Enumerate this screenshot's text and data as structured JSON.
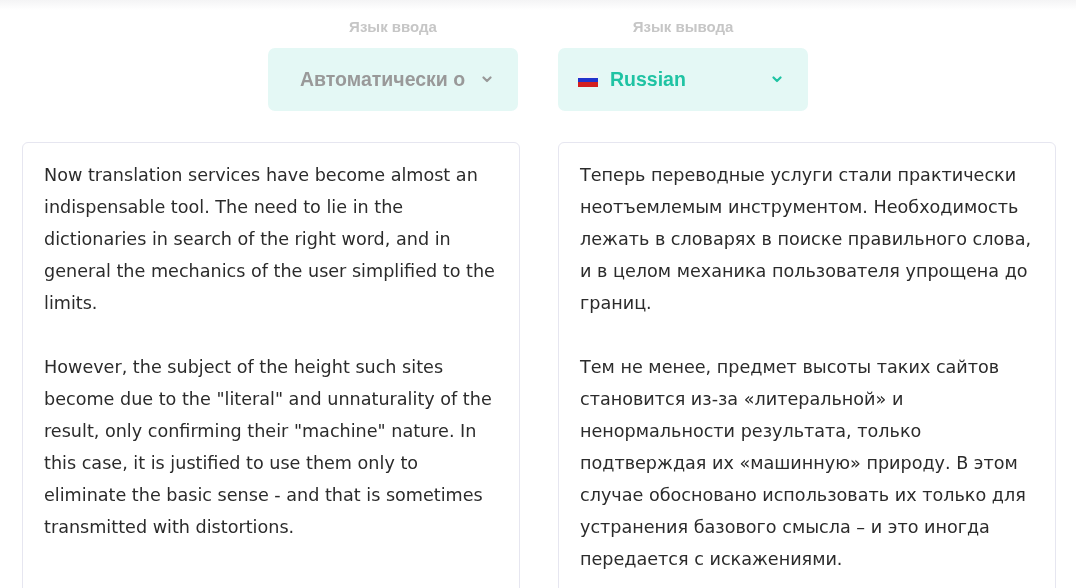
{
  "input_language": {
    "label": "Язык ввода",
    "value": "Автоматически о",
    "flag": false
  },
  "output_language": {
    "label": "Язык вывода",
    "value": "Russian",
    "flag": true
  },
  "source_text": {
    "paragraphs": [
      "Now translation services have become almost an indispensable tool. The need to lie in the dictionaries in search of the right word, and in general the mechanics of the user simplified to the limits.",
      "However, the subject of the height such sites become due to the \"literal\" and unnaturality of the result, only confirming their \"machine\" nature. In this case, it is justified to use them only to eliminate the basic sense - and that is sometimes transmitted with distortions."
    ]
  },
  "translation": {
    "paragraphs": [
      "Теперь переводные услуги стали практически неотъемлемым инструментом. Необходимость лежать в словарях в поиске правильного слова, и в целом механика пользователя упрощена до границ.",
      "Тем не менее, предмет высоты таких сайтов становится из-за «литеральной» и ненормальности результата, только подтверждая их «машинную» природу. В этом случае обосновано использовать их только для устранения базового смысла – и это иногда передается с искажениями."
    ]
  }
}
